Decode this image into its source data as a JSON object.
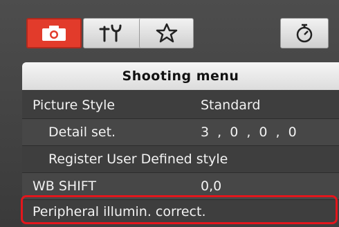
{
  "tabs": [
    {
      "name": "shooting",
      "icon": "camera-icon",
      "active": true
    },
    {
      "name": "tools",
      "icon": "tools-icon",
      "active": false
    },
    {
      "name": "my-menu",
      "icon": "star-icon",
      "active": false
    },
    {
      "name": "timer",
      "icon": "timer-icon",
      "active": false
    }
  ],
  "menu": {
    "title": "Shooting menu",
    "items": [
      {
        "label": "Picture Style",
        "value": "Standard"
      },
      {
        "label": "Detail set.",
        "value": "3 , 0 , 0 , 0"
      },
      {
        "label": "Register User Defined style",
        "value": ""
      },
      {
        "label": "WB SHIFT",
        "value": "0,0"
      },
      {
        "label": "Peripheral illumin. correct.",
        "value": ""
      }
    ]
  },
  "colors": {
    "active_tab": "#e23b2b",
    "panel_bg": "#3e3e3e",
    "highlight_border": "#e3161c"
  }
}
